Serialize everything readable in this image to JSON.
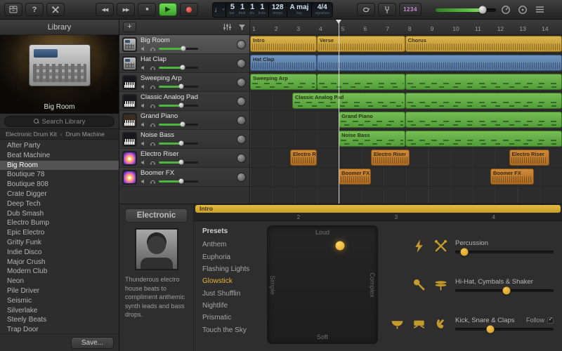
{
  "toolbar": {
    "count_in_label": "1234",
    "master_volume_pct": "78%",
    "lcd": {
      "position": {
        "bar": "5",
        "beat": "1",
        "div": "1",
        "ticks": "1"
      },
      "labels": {
        "bar": "bar",
        "beat": "beat",
        "div": "div",
        "ticks": "ticks"
      },
      "tempo": "128",
      "tempo_label": "tempo",
      "key": "A maj",
      "key_label": "key",
      "time_sig": "4/4",
      "time_sig_label": "signature"
    }
  },
  "library": {
    "title": "Library",
    "instrument_name": "Big Room",
    "search_placeholder": "Search Library",
    "breadcrumb": {
      "parent": "Electronic Drum Kit",
      "separator": "›",
      "current": "Drum Machine"
    },
    "selected": "Big Room",
    "items": [
      "After Party",
      "Beat Machine",
      "Big Room",
      "Boutique 78",
      "Boutique 808",
      "Crate Digger",
      "Deep Tech",
      "Dub Smash",
      "Electro Bump",
      "Epic Electro",
      "Gritty Funk",
      "Indie Disco",
      "Major Crush",
      "Modern Club",
      "Neon",
      "Pile Driver",
      "Seismic",
      "Silverlake",
      "Steely Beats",
      "Trap Door"
    ],
    "save_label": "Save..."
  },
  "arrange": {
    "add_track_label": "+",
    "ruler_numbers": [
      "1",
      "2",
      "3",
      "4",
      "5",
      "6",
      "7",
      "8",
      "9",
      "10",
      "11",
      "12",
      "13",
      "14"
    ],
    "playhead_left": "28.4%",
    "selected_track": "Big Room",
    "tracks": [
      {
        "name": "Big Room",
        "icon": "drum-machine",
        "volume": "62%",
        "regions": [
          {
            "label": "Intro",
            "left": "0%",
            "width": "21.4%",
            "color": "yellow",
            "pattern": "wave"
          },
          {
            "label": "Verse",
            "left": "21.4%",
            "width": "28.3%",
            "color": "yellow",
            "pattern": "wave"
          },
          {
            "label": "Chorus",
            "left": "49.7%",
            "width": "50.3%",
            "color": "yellow",
            "pattern": "wave"
          }
        ]
      },
      {
        "name": "Hat Clap",
        "icon": "drum-machine",
        "volume": "60%",
        "regions": [
          {
            "label": "Hat Clap",
            "left": "0%",
            "width": "21.4%",
            "color": "blue",
            "pattern": "wave"
          },
          {
            "label": "",
            "left": "21.4%",
            "width": "78.6%",
            "color": "blue",
            "pattern": "wave"
          }
        ]
      },
      {
        "name": "Sweeping Arp",
        "icon": "synth",
        "volume": "58%",
        "regions": [
          {
            "label": "Sweeping Arp",
            "left": "0%",
            "width": "21.4%",
            "color": "green",
            "pattern": "midi"
          },
          {
            "label": "",
            "left": "21.4%",
            "width": "28.3%",
            "color": "green",
            "pattern": "midi"
          },
          {
            "label": "",
            "left": "49.7%",
            "width": "50.3%",
            "color": "green",
            "pattern": "midi"
          }
        ]
      },
      {
        "name": "Classic Analog Pad",
        "icon": "synth",
        "volume": "58%",
        "regions": [
          {
            "label": "Classic Analog Pad",
            "left": "13.5%",
            "width": "36.2%",
            "color": "green",
            "pattern": "midi"
          },
          {
            "label": "",
            "left": "49.7%",
            "width": "50.3%",
            "color": "green",
            "pattern": "midi"
          }
        ]
      },
      {
        "name": "Grand Piano",
        "icon": "piano",
        "volume": "60%",
        "regions": [
          {
            "label": "Grand Piano",
            "left": "28.4%",
            "width": "21.3%",
            "color": "green",
            "pattern": "midi"
          },
          {
            "label": "",
            "left": "49.7%",
            "width": "50.3%",
            "color": "green",
            "pattern": "midi"
          }
        ]
      },
      {
        "name": "Noise Bass",
        "icon": "synth",
        "volume": "58%",
        "regions": [
          {
            "label": "Noise Bass",
            "left": "28.4%",
            "width": "21.3%",
            "color": "green",
            "pattern": "midi"
          },
          {
            "label": "",
            "left": "49.7%",
            "width": "50.3%",
            "color": "green",
            "pattern": "midi"
          }
        ]
      },
      {
        "name": "Electro Riser",
        "icon": "fx",
        "volume": "58%",
        "regions": [
          {
            "label": "Electro Riser",
            "left": "12.8%",
            "width": "8.6%",
            "color": "orange",
            "pattern": "wave"
          },
          {
            "label": "Electro Riser",
            "left": "38.7%",
            "width": "12.4%",
            "color": "orange",
            "pattern": "wave"
          },
          {
            "label": "Electro Riser",
            "left": "83%",
            "width": "13%",
            "color": "orange",
            "pattern": "wave"
          }
        ]
      },
      {
        "name": "Boomer FX",
        "icon": "fx",
        "volume": "58%",
        "regions": [
          {
            "label": "Boomer FX",
            "left": "28.4%",
            "width": "10.3%",
            "color": "orange",
            "pattern": "wave"
          },
          {
            "label": "Boomer FX",
            "left": "77%",
            "width": "14%",
            "color": "orange",
            "pattern": "wave"
          }
        ]
      }
    ]
  },
  "smart_controls": {
    "mini_ruler": {
      "marker_label": "Intro",
      "numbers": [
        {
          "label": "2",
          "left": "28%"
        },
        {
          "label": "3",
          "left": "54.5%"
        },
        {
          "label": "4",
          "left": "81%"
        }
      ]
    },
    "category_label": "Electronic",
    "description": "Thunderous electro house beats to compliment anthemic synth leads and bass drops.",
    "presets_title": "Presets",
    "selected_preset": "Glowstick",
    "presets": [
      "Anthem",
      "Euphoria",
      "Flashing Lights",
      "Glowstick",
      "Just Shufflin",
      "Nightlife",
      "Prismatic",
      "Touch the Sky"
    ],
    "xy_pad": {
      "top": "Loud",
      "bottom": "Soft",
      "left": "Simple",
      "right": "Complex",
      "dot": {
        "left": "66%",
        "top": "17%"
      }
    },
    "groups": [
      {
        "label": "Percussion",
        "icons": [
          "lightning",
          "drumsticks"
        ],
        "value": "9%"
      },
      {
        "label": "Hi-Hat, Cymbals & Shaker",
        "icons": [
          "maraca",
          "hihat"
        ],
        "value": "52%"
      },
      {
        "label": "Kick, Snare & Claps",
        "icons": [
          "timpani",
          "snare",
          "clap"
        ],
        "value": "36%",
        "follow_label": "Follow",
        "follow_checked": true
      }
    ]
  },
  "colors": {
    "accent_gold": "#d8a72c",
    "region_yellow": "#cda43b",
    "region_blue": "#6389b8",
    "region_green": "#63b046",
    "region_orange": "#c37f30",
    "play_green": "#55c247",
    "record_red": "#e04848",
    "count_in_purple": "#c387d6"
  }
}
